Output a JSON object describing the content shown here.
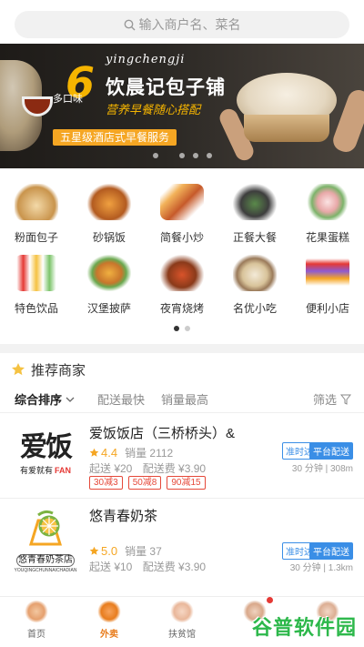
{
  "search": {
    "placeholder": "输入商户名、菜名"
  },
  "banner": {
    "number": "6",
    "number_caption": "多口味",
    "pinyin": "yingchengji",
    "shop_name": "饮晨记包子铺",
    "slogan": "营养早餐随心搭配",
    "service": "五星级酒店式早餐服务"
  },
  "categories": [
    {
      "label": "粉面包子",
      "icon": "noodle-bun-icon"
    },
    {
      "label": "砂锅饭",
      "icon": "clay-pot-rice-icon"
    },
    {
      "label": "简餐小炒",
      "icon": "stir-fry-icon"
    },
    {
      "label": "正餐大餐",
      "icon": "feast-icon"
    },
    {
      "label": "花果蛋糕",
      "icon": "cake-icon"
    },
    {
      "label": "特色饮品",
      "icon": "drinks-icon"
    },
    {
      "label": "汉堡披萨",
      "icon": "burger-icon"
    },
    {
      "label": "夜宵烧烤",
      "icon": "bbq-icon"
    },
    {
      "label": "名优小吃",
      "icon": "snack-icon"
    },
    {
      "label": "便利小店",
      "icon": "store-icon"
    }
  ],
  "recommend": {
    "title": "推荐商家"
  },
  "sort": {
    "default": "综合排序",
    "fastest": "配送最快",
    "top_sales": "销量最高",
    "filter": "筛选"
  },
  "shops": [
    {
      "name": "爱饭饭店（三桥桥头）&",
      "logo_text": "爱饭",
      "logo_sub": "有爱就有",
      "logo_fan": "FAN",
      "score": "4.4",
      "sales": "销量 2112",
      "min_order": "起送 ¥20",
      "delivery_fee": "配送费 ¥3.90",
      "tag_ontime": "准时达",
      "tag_platform": "平台配送",
      "meta": "30 分钟 | 308m",
      "promos": [
        "30减3",
        "50减8",
        "90减15"
      ]
    },
    {
      "name": "悠青春奶茶",
      "logo_text": "悠青春奶茶店",
      "logo_sub": "YOUQINGCHUNNAICHADIAN",
      "score": "5.0",
      "sales": "销量 37",
      "min_order": "起送 ¥10",
      "delivery_fee": "配送费 ¥3.90",
      "tag_ontime": "准时达",
      "tag_platform": "平台配送",
      "meta": "30 分钟 | 1.3km"
    }
  ],
  "tabs": [
    {
      "label": "首页",
      "icon": "home-icon",
      "active": false
    },
    {
      "label": "外卖",
      "icon": "takeout-icon",
      "active": true
    },
    {
      "label": "扶贫馆",
      "icon": "poverty-aid-icon",
      "active": false
    },
    {
      "label": "",
      "icon": "cart-icon",
      "active": false
    },
    {
      "label": "",
      "icon": "profile-icon",
      "active": false
    }
  ],
  "watermark": "谷普软件园",
  "colors": {
    "accent": "#f5a623",
    "blue": "#3a8ee6",
    "promo_red": "#e5493a",
    "active_tab": "#e87d1e"
  }
}
